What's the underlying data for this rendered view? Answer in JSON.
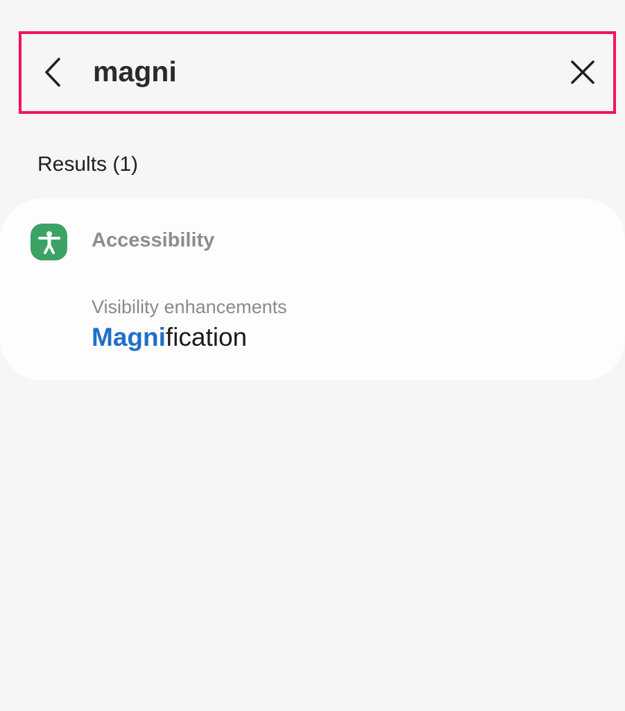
{
  "search": {
    "query": "magni"
  },
  "results": {
    "title": "Results (1)",
    "category": {
      "icon": "accessibility-icon",
      "label": "Accessibility",
      "icon_color": "#3da265"
    },
    "items": [
      {
        "path": "Visibility enhancements",
        "name_highlight": "Magni",
        "name_rest": "fication",
        "highlight_color": "#1f6fc9"
      }
    ]
  },
  "colors": {
    "focus_border": "#f2135c",
    "background": "#f6f6f6"
  }
}
